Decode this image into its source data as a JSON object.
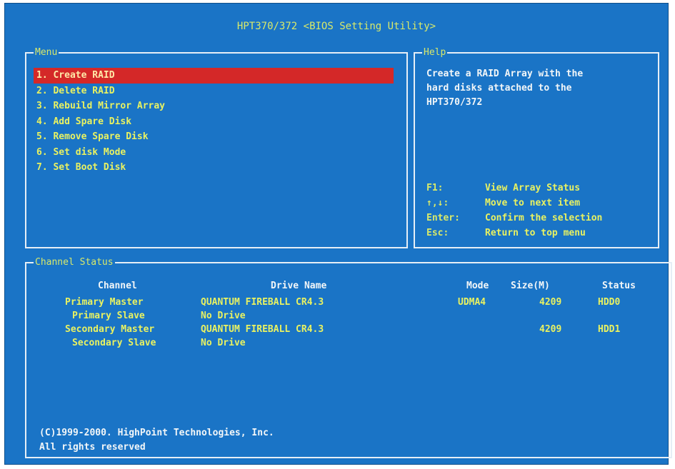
{
  "title": "HPT370/372 <BIOS Setting Utility>",
  "menu": {
    "label": "Menu",
    "items": [
      {
        "label": "1. Create RAID",
        "selected": true
      },
      {
        "label": "2. Delete RAID"
      },
      {
        "label": "3. Rebuild Mirror Array"
      },
      {
        "label": "4. Add Spare Disk"
      },
      {
        "label": "5. Remove Spare Disk"
      },
      {
        "label": "6. Set disk Mode"
      },
      {
        "label": "7. Set Boot Disk"
      }
    ]
  },
  "help": {
    "label": "Help",
    "text": "Create a RAID Array with the\nhard disks attached to the\nHPT370/372",
    "keys": [
      {
        "key": "F1:",
        "desc": "View Array Status"
      },
      {
        "key": "↑,↓:",
        "desc": "Move to next item"
      },
      {
        "key": "Enter:",
        "desc": "Confirm the selection"
      },
      {
        "key": "Esc:",
        "desc": "Return to top menu"
      }
    ]
  },
  "channel_status": {
    "label": "Channel Status",
    "headers": {
      "channel": "Channel",
      "drive": "Drive Name",
      "mode": "Mode",
      "size": "Size(M)",
      "status": "Status"
    },
    "rows": [
      {
        "channel": "Primary Master",
        "drive": "QUANTUM FIREBALL CR4.3",
        "mode": "UDMA4",
        "size": "4209",
        "status": "HDD0"
      },
      {
        "channel": "Primary Slave",
        "drive": "No Drive",
        "mode": "",
        "size": "",
        "status": ""
      },
      {
        "channel": "Secondary Master",
        "drive": "QUANTUM FIREBALL CR4.3",
        "mode": "",
        "size": "4209",
        "status": "HDD1"
      },
      {
        "channel": "Secondary Slave",
        "drive": "No Drive",
        "mode": "",
        "size": "",
        "status": ""
      }
    ],
    "copyright": "(C)1999-2000. HighPoint Technologies, Inc.\n  All rights reserved"
  },
  "colors": {
    "background": "#1a74c6",
    "text_yellow": "#e9f261",
    "text_white": "#f2f6f8",
    "selection": "#d42828"
  }
}
